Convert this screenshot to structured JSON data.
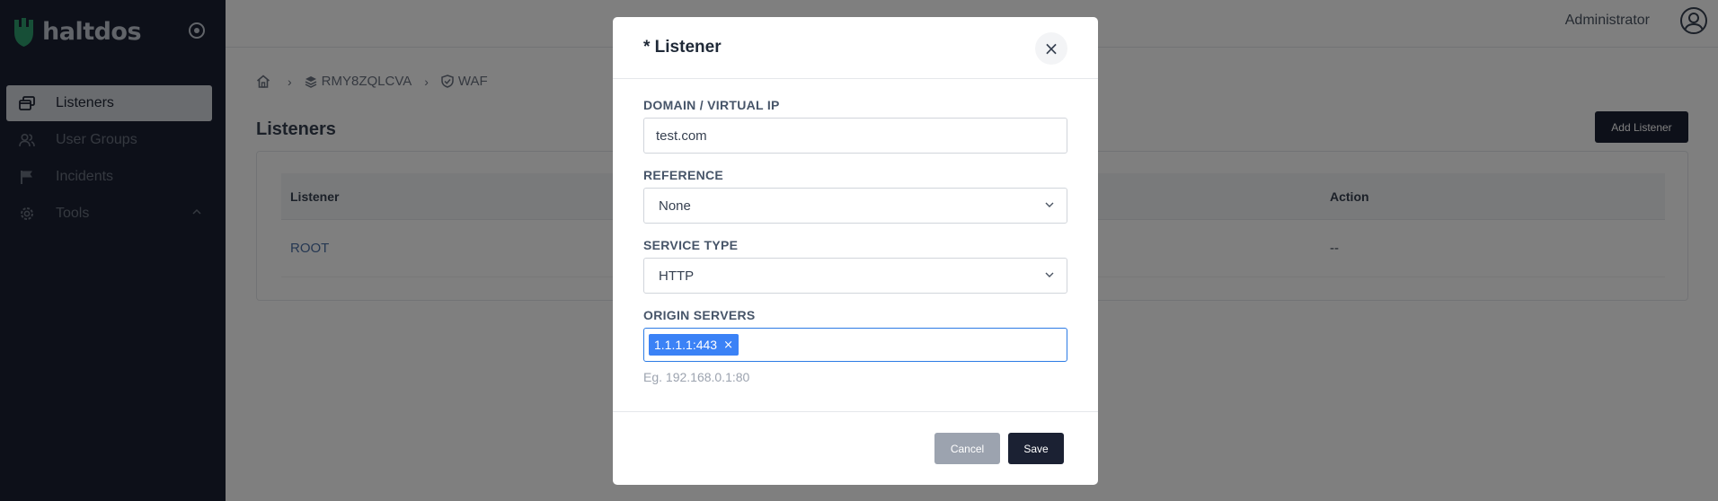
{
  "app": {
    "logo_text": "haltdos"
  },
  "sidebar": {
    "items": [
      {
        "label": "Listeners",
        "icon": "windows-icon",
        "active": true
      },
      {
        "label": "User Groups",
        "icon": "users-icon",
        "active": false
      },
      {
        "label": "Incidents",
        "icon": "flag-icon",
        "active": false
      },
      {
        "label": "Tools",
        "icon": "gear-icon",
        "active": false
      }
    ]
  },
  "topbar": {
    "user_name": "Administrator"
  },
  "breadcrumb": {
    "items": [
      {
        "label": "",
        "icon": "home-icon"
      },
      {
        "label": "RMY8ZQLCVA",
        "icon": "layers-icon"
      },
      {
        "label": "WAF",
        "icon": "shield-icon"
      }
    ],
    "separator": "›"
  },
  "page": {
    "title": "Listeners",
    "add_button": "Add Listener"
  },
  "table": {
    "headers": [
      "Listener",
      "Action"
    ],
    "rows": [
      {
        "listener": "ROOT",
        "action": "--"
      }
    ]
  },
  "modal": {
    "title": "* Listener",
    "close_glyph": "×",
    "fields": {
      "domain": {
        "label": "DOMAIN / VIRTUAL IP",
        "value": "test.com"
      },
      "reference": {
        "label": "REFERENCE",
        "value": "None"
      },
      "service_type": {
        "label": "SERVICE TYPE",
        "value": "HTTP"
      },
      "origin_servers": {
        "label": "ORIGIN SERVERS",
        "tags": [
          "1.1.1.1:443"
        ],
        "tag_remove_glyph": "×",
        "hint": "Eg. 192.168.0.1:80"
      }
    },
    "buttons": {
      "cancel": "Cancel",
      "save": "Save"
    }
  },
  "colors": {
    "sidebar_bg": "#1b2133",
    "primary_button": "#1b2133",
    "tag_bg": "#3b82f6",
    "focus_border": "#2c7be5",
    "link": "#4a6fa5"
  }
}
